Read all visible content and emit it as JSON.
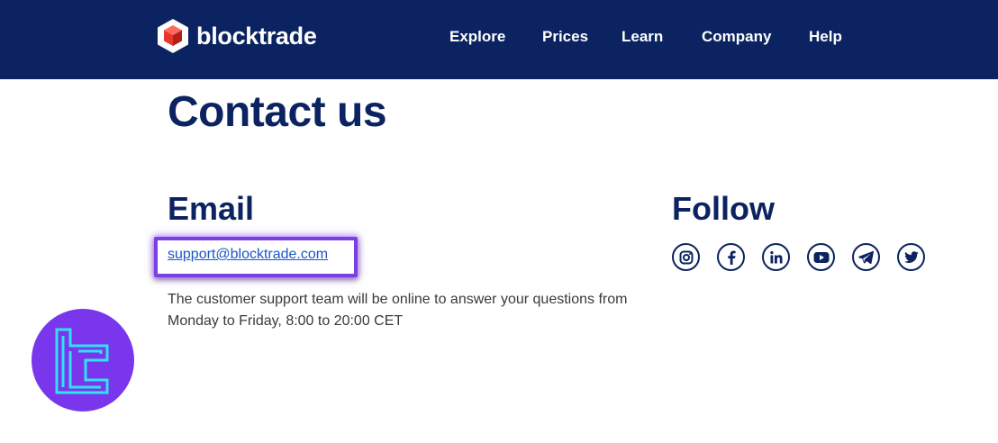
{
  "header": {
    "brand": "blocktrade",
    "nav": [
      "Explore",
      "Prices",
      "Learn",
      "Company",
      "Help"
    ]
  },
  "page": {
    "title": "Contact us"
  },
  "email": {
    "heading": "Email",
    "address": "support@blocktrade.com",
    "description": "The customer support team will be online to answer your questions from Monday to Friday, 8:00 to 20:00 CET"
  },
  "follow": {
    "heading": "Follow",
    "icons": [
      "instagram-icon",
      "facebook-icon",
      "linkedin-icon",
      "youtube-icon",
      "telegram-icon",
      "twitter-icon"
    ]
  },
  "colors": {
    "header_bg": "#0b2360",
    "heading": "#0b2360",
    "link": "#1a56c8",
    "highlight": "#7b3fe4",
    "badge_bg": "#7a36ec",
    "badge_fg": "#2fe2f5"
  }
}
